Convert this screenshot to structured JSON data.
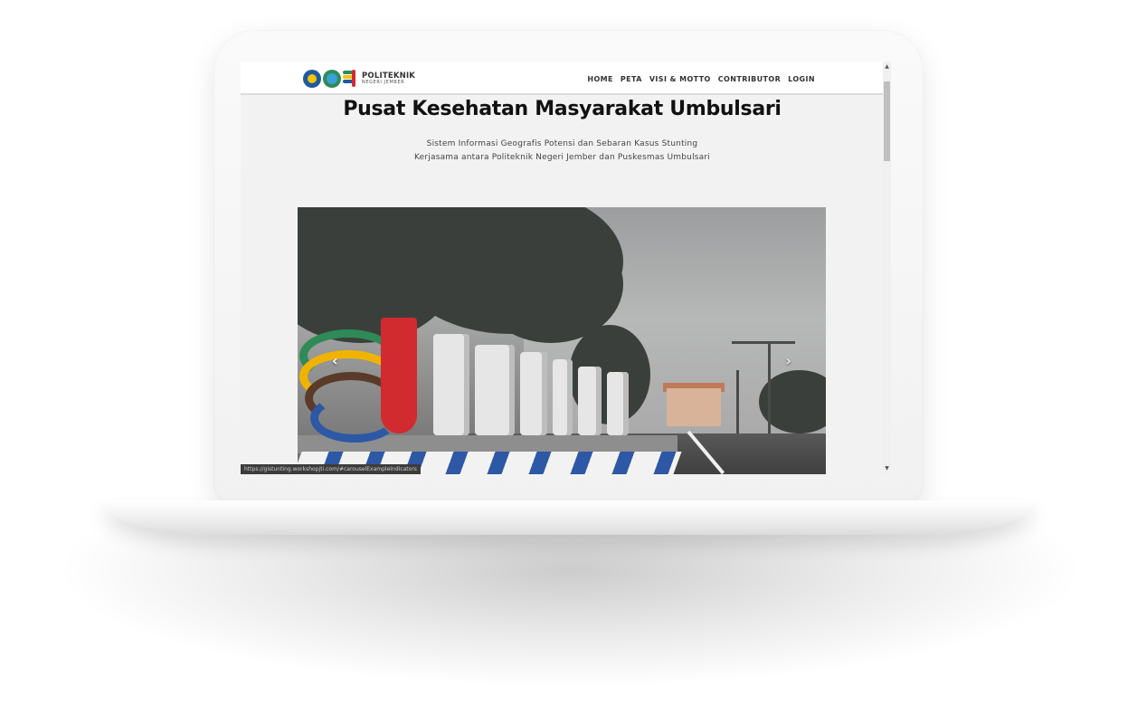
{
  "navbar": {
    "brand_top": "POLITEKNIK",
    "brand_bottom": "NEGERI JEMBER",
    "items": [
      "HOME",
      "PETA",
      "VISI & MOTTO",
      "CONTRIBUTOR",
      "LOGIN"
    ]
  },
  "hero": {
    "title": "Pusat Kesehatan Masyarakat Umbulsari",
    "subtitle_line1": "Sistem Informasi Geografis Potensi dan Sebaran Kasus Stunting",
    "subtitle_line2": "Kerjasama antara Politeknik Negeri Jember dan Puskesmas Umbulsari"
  },
  "carousel": {
    "prev_label": "‹",
    "next_label": "›"
  },
  "status_url": "https://gistunting.workshopjti.com/#carouselExampleIndicators",
  "scrollbar": {
    "up_glyph": "▲",
    "down_glyph": "▼"
  },
  "colors": {
    "polije_red": "#d12a2f",
    "polije_blue": "#2d58a5"
  }
}
